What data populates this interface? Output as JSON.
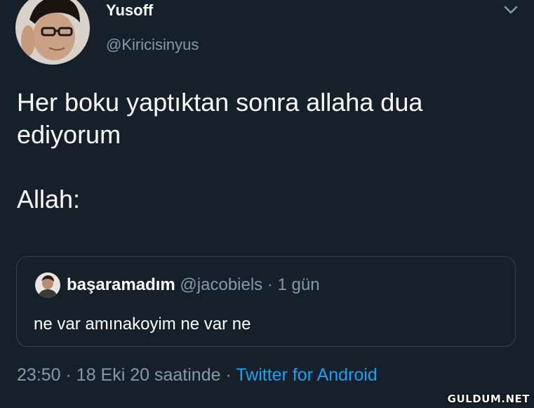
{
  "tweet": {
    "author_name": "Yusoff",
    "author_handle": "@Kiricisinyus",
    "text_line1": "Her boku yaptıktan sonra allaha dua",
    "text_line2": "ediyorum",
    "text_line3": "Allah:"
  },
  "quote": {
    "author_name": "başaramadım",
    "author_handle": "@jacobiels",
    "separator": "·",
    "time": "1 gün",
    "text": "ne var amınakoyim ne var ne"
  },
  "footer": {
    "time": "23:50",
    "separator": "·",
    "date_text": "18 Eki 20 saatinde",
    "source": "Twitter for Android"
  },
  "watermark": "GULDUM.NET",
  "icons": {
    "menu": "chevron-down-icon"
  },
  "colors": {
    "background": "#15202b",
    "text": "#ffffff",
    "muted": "#8899a6",
    "link": "#1da1f2",
    "border": "#38444d"
  }
}
